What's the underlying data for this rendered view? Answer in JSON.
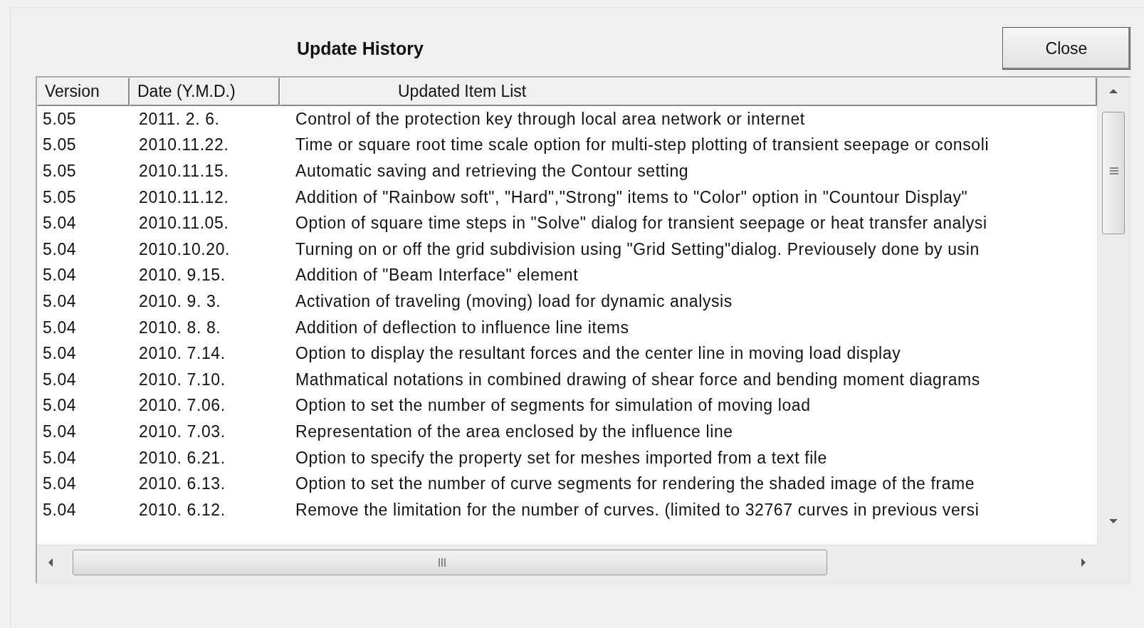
{
  "dialog": {
    "title": "Update History",
    "close_button": "Close"
  },
  "table": {
    "columns": [
      "Version",
      "Date (Y.M.D.)",
      "Updated Item List"
    ],
    "rows": [
      {
        "version": "5.05",
        "date": "2011. 2. 6.",
        "item": "Control of the protection key through local area network or internet"
      },
      {
        "version": "5.05",
        "date": "2010.11.22.",
        "item": "Time or square root time scale option for multi-step plotting of transient seepage or consoli"
      },
      {
        "version": "5.05",
        "date": "2010.11.15.",
        "item": "Automatic saving and retrieving the Contour setting"
      },
      {
        "version": "5.05",
        "date": "2010.11.12.",
        "item": "Addition of \"Rainbow soft\", \"Hard\",\"Strong\" items to \"Color\" option in \"Countour Display\""
      },
      {
        "version": "5.04",
        "date": "2010.11.05.",
        "item": "Option of square time steps in \"Solve\" dialog for transient seepage or heat transfer analysi"
      },
      {
        "version": "5.04",
        "date": "2010.10.20.",
        "item": "Turning on or off the grid subdivision using \"Grid Setting\"dialog. Previousely done by usin"
      },
      {
        "version": "5.04",
        "date": "2010. 9.15.",
        "item": "Addition of \"Beam Interface\" element"
      },
      {
        "version": "5.04",
        "date": "2010. 9. 3.",
        "item": "Activation of traveling (moving) load for dynamic analysis"
      },
      {
        "version": "5.04",
        "date": "2010. 8. 8.",
        "item": "Addition of deflection to influence line items"
      },
      {
        "version": "5.04",
        "date": "2010. 7.14.",
        "item": "Option to display the resultant forces and the center line in moving load display"
      },
      {
        "version": "5.04",
        "date": "2010. 7.10.",
        "item": "Mathmatical notations in combined drawing of shear force and bending moment diagrams"
      },
      {
        "version": "5.04",
        "date": "2010. 7.06.",
        "item": "Option to set the number of segments for simulation of moving load"
      },
      {
        "version": "5.04",
        "date": "2010. 7.03.",
        "item": "Representation of the area enclosed by the influence line"
      },
      {
        "version": "5.04",
        "date": "2010. 6.21.",
        "item": "Option to specify the property set for meshes imported from a text file"
      },
      {
        "version": "5.04",
        "date": "2010. 6.13.",
        "item": "Option to set the number of curve segments for rendering the shaded image of the frame"
      },
      {
        "version": "5.04",
        "date": "2010. 6.12.",
        "item": "Remove the limitation for the number of curves. (limited to 32767 curves in previous versi"
      }
    ]
  }
}
